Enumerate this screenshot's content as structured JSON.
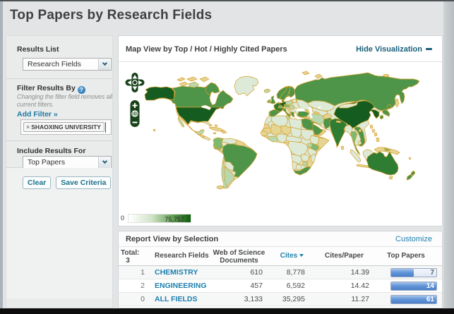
{
  "window": {
    "page_title": "Top Papers by Research Fields"
  },
  "sidebar": {
    "results_list": {
      "label": "Results List",
      "selected": "Research Fields"
    },
    "filter": {
      "label": "Filter Results By",
      "help_icon": "?",
      "note": "Changing the filter field removes all current filters.",
      "add_filter_link": "Add Filter »",
      "tag_remove": "×",
      "tag_text": "SHAOXING UNIVERSITY"
    },
    "include_results": {
      "label": "Include Results For",
      "selected": "Top Papers"
    },
    "buttons": {
      "clear": "Clear",
      "save": "Save Criteria"
    }
  },
  "map_panel": {
    "title": "Map View by Top / Hot / Highly Cited Papers",
    "hide_link": "Hide Visualization",
    "legend": {
      "min": "0",
      "max": "75,757",
      "gradient_start": "#ffffff",
      "gradient_end": "#0c5c0c"
    }
  },
  "map": {
    "border_color": "#d7a02c",
    "palette": {
      "L0": "#e6d492",
      "L1": "#dcead7",
      "L2": "#b9d8ae",
      "L3": "#7fb96f",
      "L4": "#4e9549",
      "L5": "#2e7d33",
      "L6": "#155c20"
    },
    "sea_color": "#ffffff",
    "controls": [
      "pan-up",
      "pan-left",
      "pan-right",
      "pan-down",
      "zoom-in",
      "zoom-world",
      "zoom-out"
    ]
  },
  "report": {
    "title": "Report View by Selection",
    "customize_link": "Customize",
    "total_label": "Total:",
    "total_count": "3",
    "columns": [
      "Research Fields",
      "Web of Science Documents",
      "Cites",
      "Cites/Paper",
      "Top Papers"
    ],
    "col_wos_line1": "Web of Science",
    "col_wos_line2": "Documents",
    "sorted_by": "Cites",
    "rows": [
      {
        "index": "1",
        "field": "CHEMISTRY",
        "wos_documents": "610",
        "cites": "8,778",
        "cites_per_paper": "14.39",
        "top_papers": "7",
        "bar_pct": 50
      },
      {
        "index": "2",
        "field": "ENGINEERING",
        "wos_documents": "457",
        "cites": "6,592",
        "cites_per_paper": "14.42",
        "top_papers": "14",
        "bar_pct": 100
      },
      {
        "index": "0",
        "field": "ALL FIELDS",
        "wos_documents": "3,133",
        "cites": "35,295",
        "cites_per_paper": "11.27",
        "top_papers": "61",
        "bar_pct": 100
      }
    ]
  }
}
